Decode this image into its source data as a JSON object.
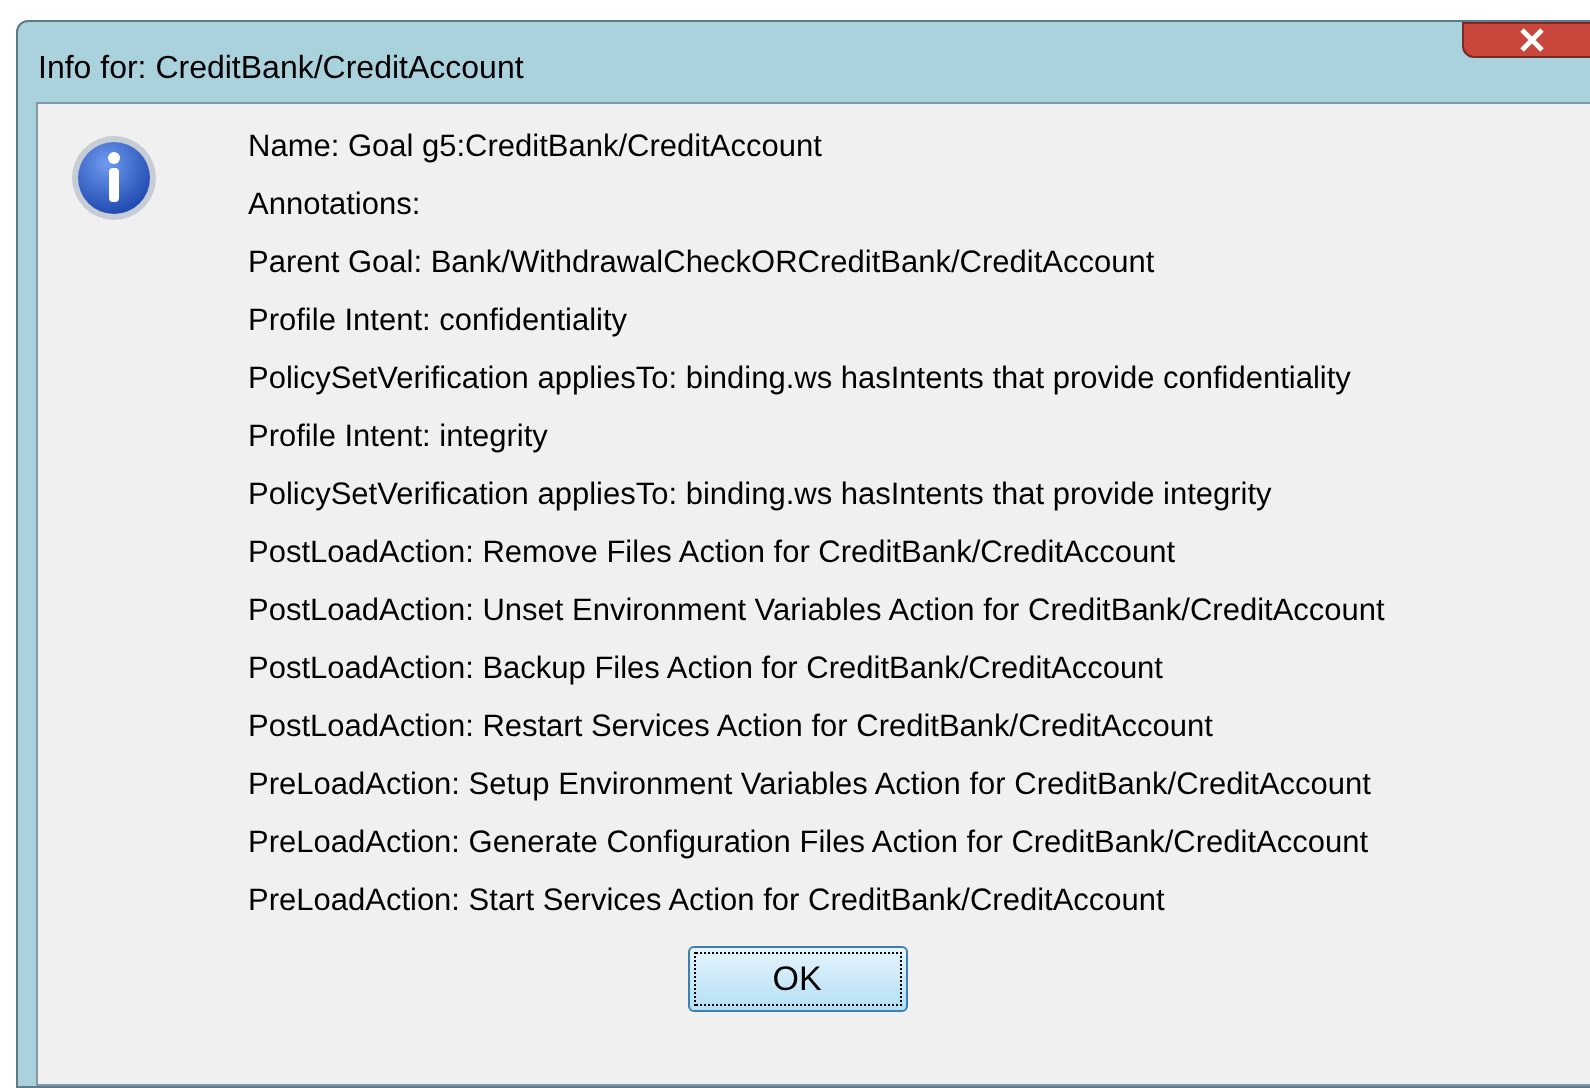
{
  "window": {
    "title": "Info for: CreditBank/CreditAccount"
  },
  "lines": [
    "Name: Goal g5:CreditBank/CreditAccount",
    "Annotations:",
    "Parent Goal: Bank/WithdrawalCheckORCreditBank/CreditAccount",
    "Profile Intent: confidentiality",
    "PolicySetVerification appliesTo: binding.ws hasIntents that provide confidentiality",
    "Profile Intent: integrity",
    "PolicySetVerification appliesTo: binding.ws hasIntents that provide integrity",
    "PostLoadAction: Remove Files Action for CreditBank/CreditAccount",
    "PostLoadAction: Unset Environment Variables Action for CreditBank/CreditAccount",
    "PostLoadAction: Backup Files Action for CreditBank/CreditAccount",
    "PostLoadAction: Restart Services Action for CreditBank/CreditAccount",
    "PreLoadAction: Setup Environment Variables Action for CreditBank/CreditAccount",
    "PreLoadAction: Generate Configuration Files Action for CreditBank/CreditAccount",
    "PreLoadAction: Start Services Action for CreditBank/CreditAccount"
  ],
  "buttons": [
    "OK"
  ]
}
